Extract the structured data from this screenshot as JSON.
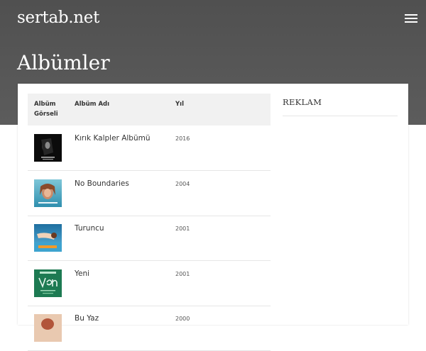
{
  "site": {
    "logo": "sertab.net"
  },
  "page": {
    "title": "Albümler"
  },
  "table": {
    "headers": {
      "cover": "Albüm Görseli",
      "name": "Albüm Adı",
      "year": "Yıl"
    },
    "rows": [
      {
        "name": "Kırık Kalpler Albümü",
        "year": "2016"
      },
      {
        "name": "No Boundaries",
        "year": "2004"
      },
      {
        "name": "Turuncu",
        "year": "2001"
      },
      {
        "name": "Yeni",
        "year": "2001"
      },
      {
        "name": "Bu Yaz",
        "year": "2000"
      }
    ]
  },
  "sidebar": {
    "ad_title": "REKLAM"
  },
  "icons": {
    "menu": "hamburger-menu-icon"
  }
}
